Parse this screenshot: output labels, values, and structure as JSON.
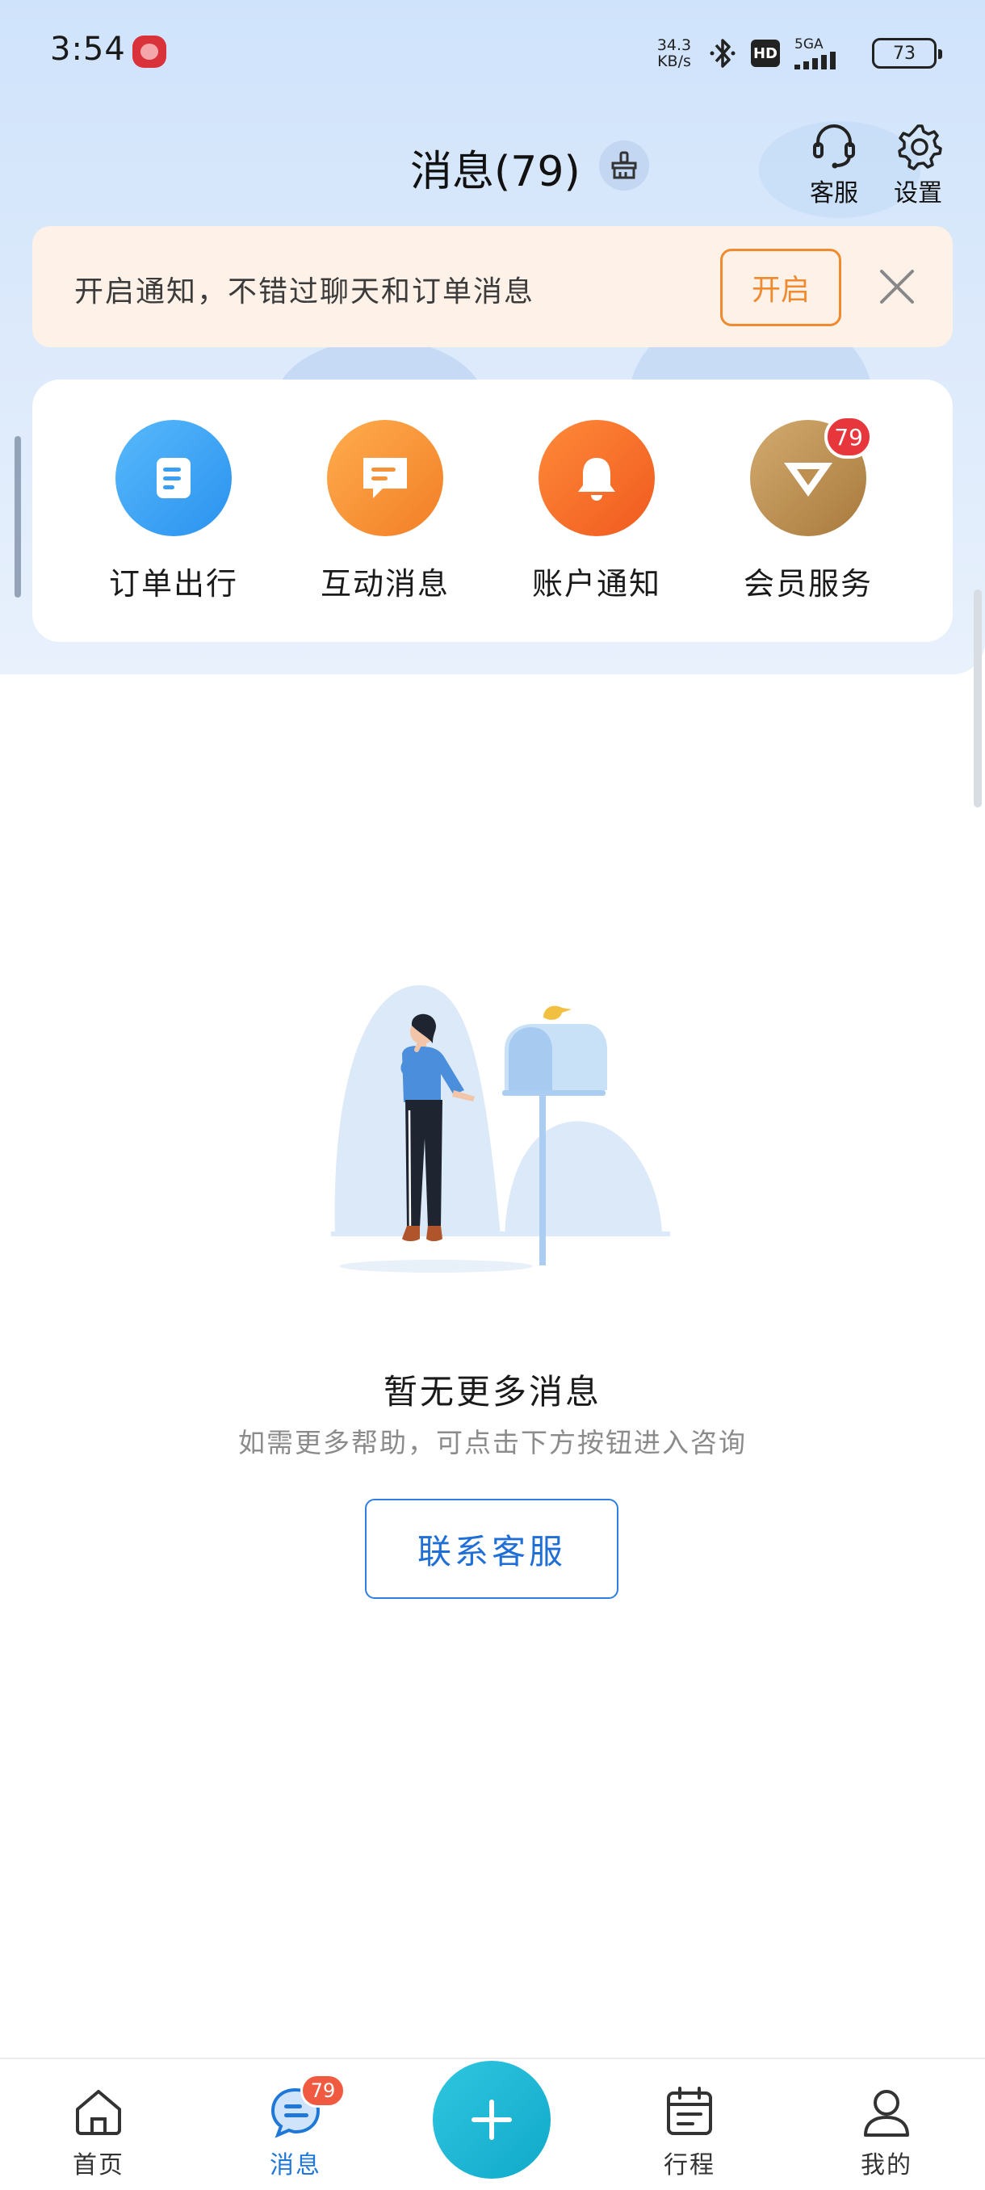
{
  "status_bar": {
    "time": "3:54",
    "net_speed_value": "34.3",
    "net_speed_unit": "KB/s",
    "hd_label": "HD",
    "network_label": "5GA",
    "battery": "73"
  },
  "header": {
    "title": "消息(79)",
    "customer_service_label": "客服",
    "settings_label": "设置"
  },
  "notify_banner": {
    "text": "开启通知，不错过聊天和订单消息",
    "enable_label": "开启"
  },
  "categories": [
    {
      "label": "订单出行",
      "icon": "order-doc-icon",
      "color": "#3ea6f3"
    },
    {
      "label": "互动消息",
      "icon": "chat-bubble-icon",
      "color": "#f6953a"
    },
    {
      "label": "账户通知",
      "icon": "bell-icon",
      "color": "#f46f27"
    },
    {
      "label": "会员服务",
      "icon": "vip-diamond-icon",
      "color": "#c69a5c",
      "badge": "79"
    }
  ],
  "empty_state": {
    "title": "暂无更多消息",
    "subtitle": "如需更多帮助，可点击下方按钮进入咨询",
    "button_label": "联系客服"
  },
  "bottom_nav": {
    "items": [
      {
        "label": "首页",
        "icon": "home-icon"
      },
      {
        "label": "消息",
        "icon": "message-icon",
        "badge": "79",
        "active": true
      },
      {
        "label": "行程",
        "icon": "calendar-icon"
      },
      {
        "label": "我的",
        "icon": "profile-icon"
      }
    ],
    "fab_icon": "plus-icon"
  },
  "colors": {
    "accent_blue": "#1f78d8",
    "accent_orange": "#f08a2e",
    "badge_red": "#e8373c",
    "fab_teal": "#18b4d3"
  }
}
